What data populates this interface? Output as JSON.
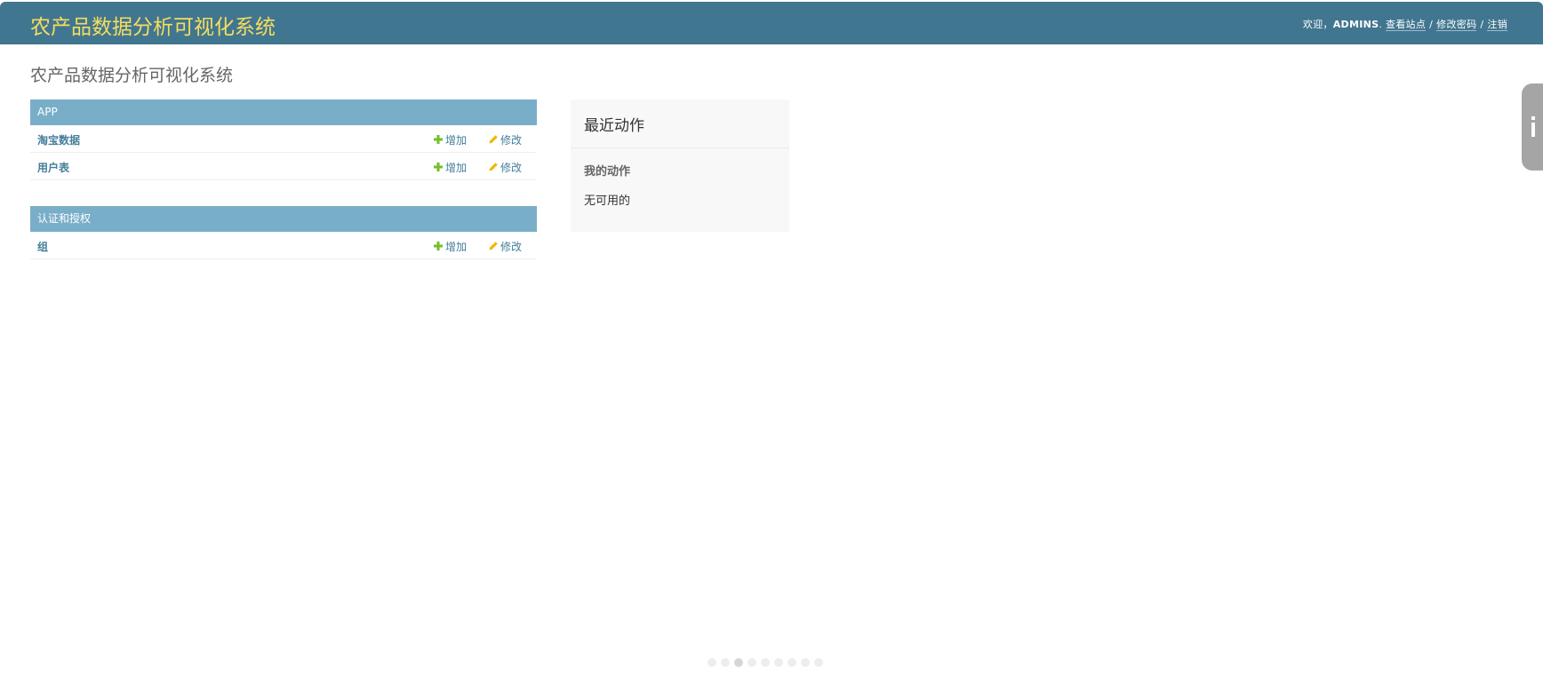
{
  "header": {
    "branding": "农产品数据分析可视化系统",
    "welcome": "欢迎，",
    "username": "ADMINS",
    "username_suffix": ".",
    "view_site": "查看站点",
    "separator": "/",
    "change_password": "修改密码",
    "logout": "注销"
  },
  "page_title": "农产品数据分析可视化系统",
  "modules": [
    {
      "name": "APP",
      "models": [
        {
          "name": "淘宝数据",
          "add": "增加",
          "change": "修改"
        },
        {
          "name": "用户表",
          "add": "增加",
          "change": "修改"
        }
      ]
    },
    {
      "name": "认证和授权",
      "models": [
        {
          "name": "组",
          "add": "增加",
          "change": "修改"
        }
      ]
    }
  ],
  "recent_actions": {
    "title": "最近动作",
    "subtitle": "我的动作",
    "empty": "无可用的"
  },
  "colors": {
    "header_bg": "#417690",
    "branding": "#f5dd5d",
    "module_header_bg": "#79aec8",
    "link": "#447e9b",
    "add_icon": "#70bf2b",
    "change_icon": "#efb80b"
  },
  "icons": {
    "add": "plus-icon",
    "change": "pencil-icon",
    "side_tab": "info-icon"
  },
  "pager": {
    "dot_count": 9,
    "active_index": 2
  }
}
